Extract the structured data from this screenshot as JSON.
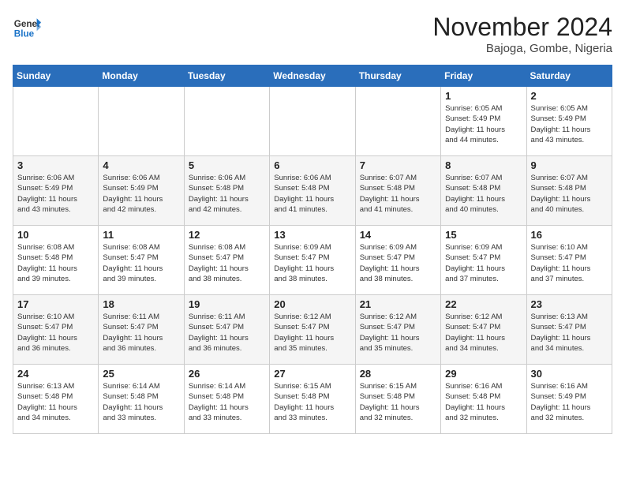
{
  "header": {
    "logo_line1": "General",
    "logo_line2": "Blue",
    "month": "November 2024",
    "location": "Bajoga, Gombe, Nigeria"
  },
  "weekdays": [
    "Sunday",
    "Monday",
    "Tuesday",
    "Wednesday",
    "Thursday",
    "Friday",
    "Saturday"
  ],
  "weeks": [
    [
      {
        "day": "",
        "info": ""
      },
      {
        "day": "",
        "info": ""
      },
      {
        "day": "",
        "info": ""
      },
      {
        "day": "",
        "info": ""
      },
      {
        "day": "",
        "info": ""
      },
      {
        "day": "1",
        "info": "Sunrise: 6:05 AM\nSunset: 5:49 PM\nDaylight: 11 hours\nand 44 minutes."
      },
      {
        "day": "2",
        "info": "Sunrise: 6:05 AM\nSunset: 5:49 PM\nDaylight: 11 hours\nand 43 minutes."
      }
    ],
    [
      {
        "day": "3",
        "info": "Sunrise: 6:06 AM\nSunset: 5:49 PM\nDaylight: 11 hours\nand 43 minutes."
      },
      {
        "day": "4",
        "info": "Sunrise: 6:06 AM\nSunset: 5:49 PM\nDaylight: 11 hours\nand 42 minutes."
      },
      {
        "day": "5",
        "info": "Sunrise: 6:06 AM\nSunset: 5:48 PM\nDaylight: 11 hours\nand 42 minutes."
      },
      {
        "day": "6",
        "info": "Sunrise: 6:06 AM\nSunset: 5:48 PM\nDaylight: 11 hours\nand 41 minutes."
      },
      {
        "day": "7",
        "info": "Sunrise: 6:07 AM\nSunset: 5:48 PM\nDaylight: 11 hours\nand 41 minutes."
      },
      {
        "day": "8",
        "info": "Sunrise: 6:07 AM\nSunset: 5:48 PM\nDaylight: 11 hours\nand 40 minutes."
      },
      {
        "day": "9",
        "info": "Sunrise: 6:07 AM\nSunset: 5:48 PM\nDaylight: 11 hours\nand 40 minutes."
      }
    ],
    [
      {
        "day": "10",
        "info": "Sunrise: 6:08 AM\nSunset: 5:48 PM\nDaylight: 11 hours\nand 39 minutes."
      },
      {
        "day": "11",
        "info": "Sunrise: 6:08 AM\nSunset: 5:47 PM\nDaylight: 11 hours\nand 39 minutes."
      },
      {
        "day": "12",
        "info": "Sunrise: 6:08 AM\nSunset: 5:47 PM\nDaylight: 11 hours\nand 38 minutes."
      },
      {
        "day": "13",
        "info": "Sunrise: 6:09 AM\nSunset: 5:47 PM\nDaylight: 11 hours\nand 38 minutes."
      },
      {
        "day": "14",
        "info": "Sunrise: 6:09 AM\nSunset: 5:47 PM\nDaylight: 11 hours\nand 38 minutes."
      },
      {
        "day": "15",
        "info": "Sunrise: 6:09 AM\nSunset: 5:47 PM\nDaylight: 11 hours\nand 37 minutes."
      },
      {
        "day": "16",
        "info": "Sunrise: 6:10 AM\nSunset: 5:47 PM\nDaylight: 11 hours\nand 37 minutes."
      }
    ],
    [
      {
        "day": "17",
        "info": "Sunrise: 6:10 AM\nSunset: 5:47 PM\nDaylight: 11 hours\nand 36 minutes."
      },
      {
        "day": "18",
        "info": "Sunrise: 6:11 AM\nSunset: 5:47 PM\nDaylight: 11 hours\nand 36 minutes."
      },
      {
        "day": "19",
        "info": "Sunrise: 6:11 AM\nSunset: 5:47 PM\nDaylight: 11 hours\nand 36 minutes."
      },
      {
        "day": "20",
        "info": "Sunrise: 6:12 AM\nSunset: 5:47 PM\nDaylight: 11 hours\nand 35 minutes."
      },
      {
        "day": "21",
        "info": "Sunrise: 6:12 AM\nSunset: 5:47 PM\nDaylight: 11 hours\nand 35 minutes."
      },
      {
        "day": "22",
        "info": "Sunrise: 6:12 AM\nSunset: 5:47 PM\nDaylight: 11 hours\nand 34 minutes."
      },
      {
        "day": "23",
        "info": "Sunrise: 6:13 AM\nSunset: 5:47 PM\nDaylight: 11 hours\nand 34 minutes."
      }
    ],
    [
      {
        "day": "24",
        "info": "Sunrise: 6:13 AM\nSunset: 5:48 PM\nDaylight: 11 hours\nand 34 minutes."
      },
      {
        "day": "25",
        "info": "Sunrise: 6:14 AM\nSunset: 5:48 PM\nDaylight: 11 hours\nand 33 minutes."
      },
      {
        "day": "26",
        "info": "Sunrise: 6:14 AM\nSunset: 5:48 PM\nDaylight: 11 hours\nand 33 minutes."
      },
      {
        "day": "27",
        "info": "Sunrise: 6:15 AM\nSunset: 5:48 PM\nDaylight: 11 hours\nand 33 minutes."
      },
      {
        "day": "28",
        "info": "Sunrise: 6:15 AM\nSunset: 5:48 PM\nDaylight: 11 hours\nand 32 minutes."
      },
      {
        "day": "29",
        "info": "Sunrise: 6:16 AM\nSunset: 5:48 PM\nDaylight: 11 hours\nand 32 minutes."
      },
      {
        "day": "30",
        "info": "Sunrise: 6:16 AM\nSunset: 5:49 PM\nDaylight: 11 hours\nand 32 minutes."
      }
    ]
  ]
}
